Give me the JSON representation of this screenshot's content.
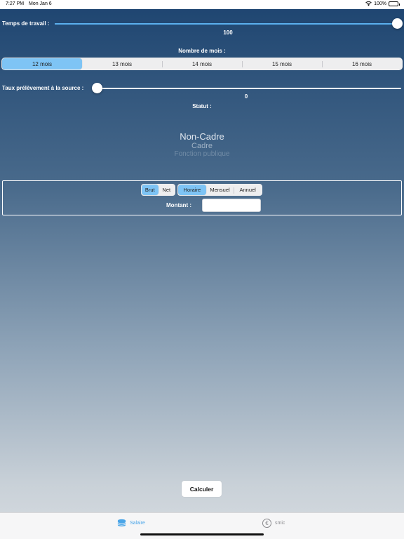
{
  "status_bar": {
    "time": "7:27 PM",
    "date": "Mon Jan 6",
    "battery": "100%"
  },
  "work_time": {
    "label": "Temps de travail :",
    "value": "100",
    "slider_fraction": 1.0
  },
  "months": {
    "label": "Nombre de mois :",
    "options": [
      "12 mois",
      "13 mois",
      "14 mois",
      "15 mois",
      "16 mois"
    ],
    "selected_index": 0
  },
  "tax_rate": {
    "label": "Taux prélèvement à la source :",
    "value": "0",
    "slider_fraction": 0.0
  },
  "status": {
    "label": "Statut :",
    "options": [
      "Non-Cadre",
      "Cadre",
      "Fonction publique"
    ],
    "selected_index": 0
  },
  "salary_type": {
    "options": [
      "Brut",
      "Net"
    ],
    "selected_index": 0
  },
  "period": {
    "options": [
      "Horaire",
      "Mensuel",
      "Annuel"
    ],
    "selected_index": 0
  },
  "amount": {
    "label": "Montant :",
    "value": "",
    "placeholder": ""
  },
  "calculate_label": "Calculer",
  "tabs": [
    {
      "label": "Salaire",
      "icon": "coins-icon",
      "active": true
    },
    {
      "label": "smic",
      "icon": "euro-icon",
      "active": false
    }
  ],
  "colors": {
    "accent": "#5ab0ee",
    "selected_segment": "#7ec4f5",
    "tab_active": "#4aa5e8",
    "tab_inactive": "#8a8a8e"
  }
}
